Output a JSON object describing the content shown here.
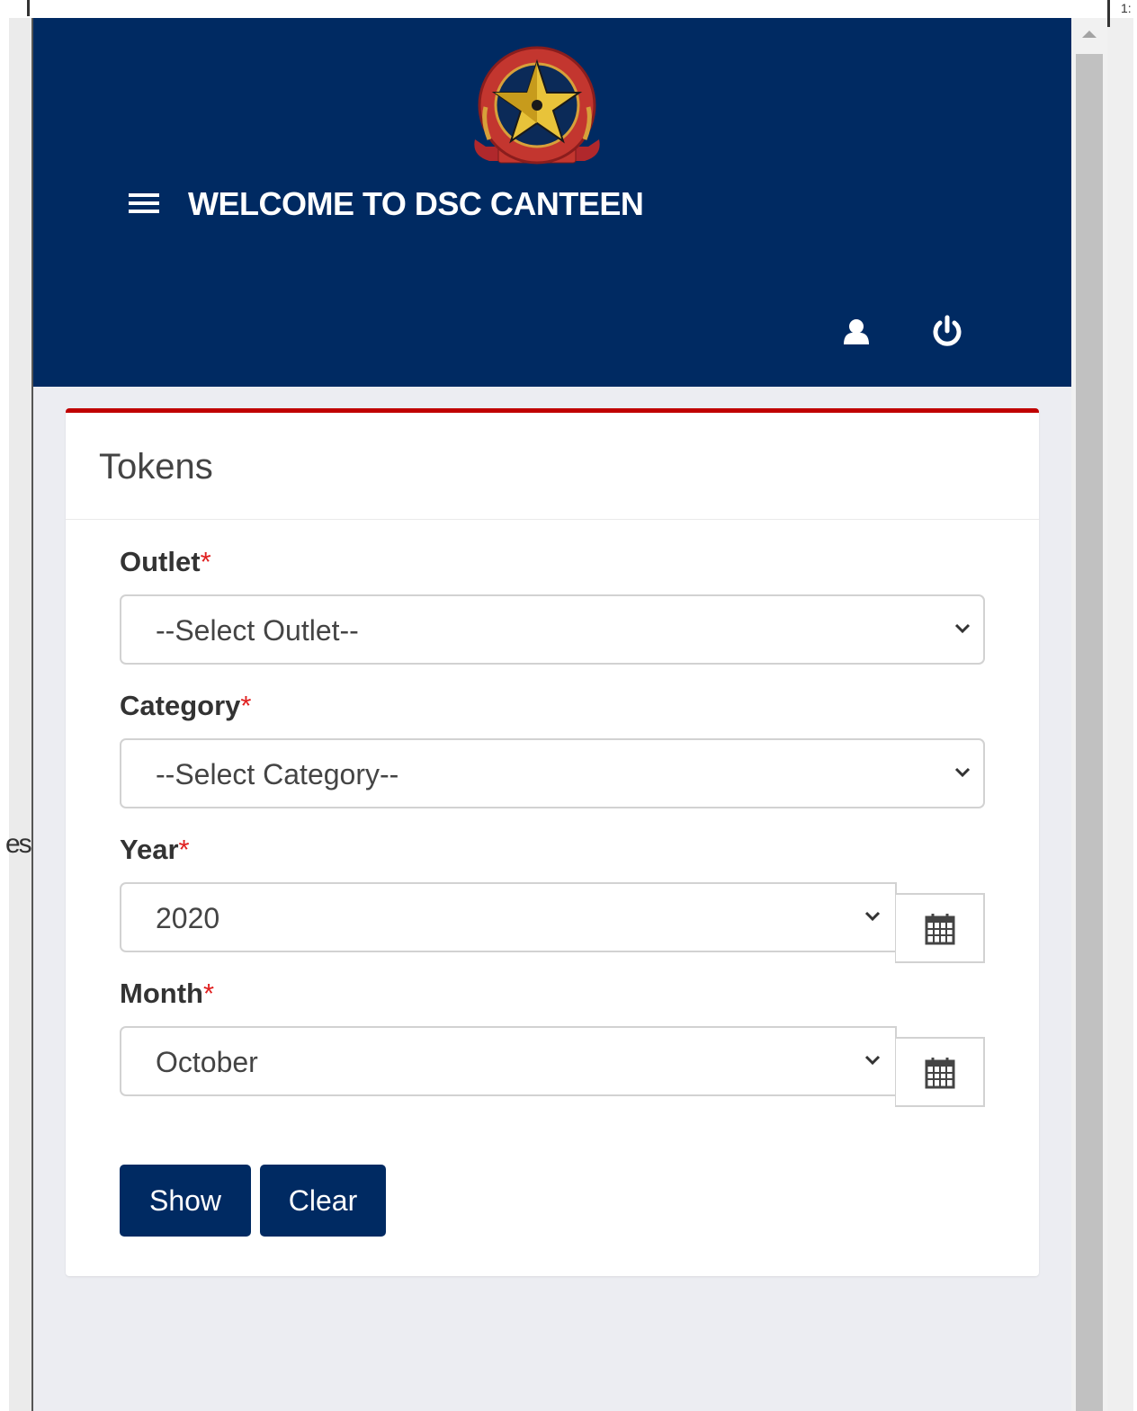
{
  "header": {
    "title": "WELCOME TO DSC CANTEEN"
  },
  "card": {
    "title": "Tokens"
  },
  "form": {
    "outlet": {
      "label": "Outlet",
      "required_mark": "*",
      "value": "--Select Outlet--"
    },
    "category": {
      "label": "Category",
      "required_mark": "*",
      "value": "--Select Category--"
    },
    "year": {
      "label": "Year",
      "required_mark": "*",
      "value": "2020"
    },
    "month": {
      "label": "Month",
      "required_mark": "*",
      "value": "October"
    }
  },
  "buttons": {
    "show": "Show",
    "clear": "Clear"
  },
  "background": {
    "fragment_text": "es",
    "fragment_text_right": "1:"
  },
  "colors": {
    "header_bg": "#002a62",
    "accent_border": "#c00000",
    "required": "#e02020",
    "button_bg": "#002a62"
  },
  "icons": [
    "hamburger-menu-icon",
    "user-icon",
    "power-icon",
    "chevron-down-icon",
    "calendar-icon",
    "dsc-logo"
  ]
}
